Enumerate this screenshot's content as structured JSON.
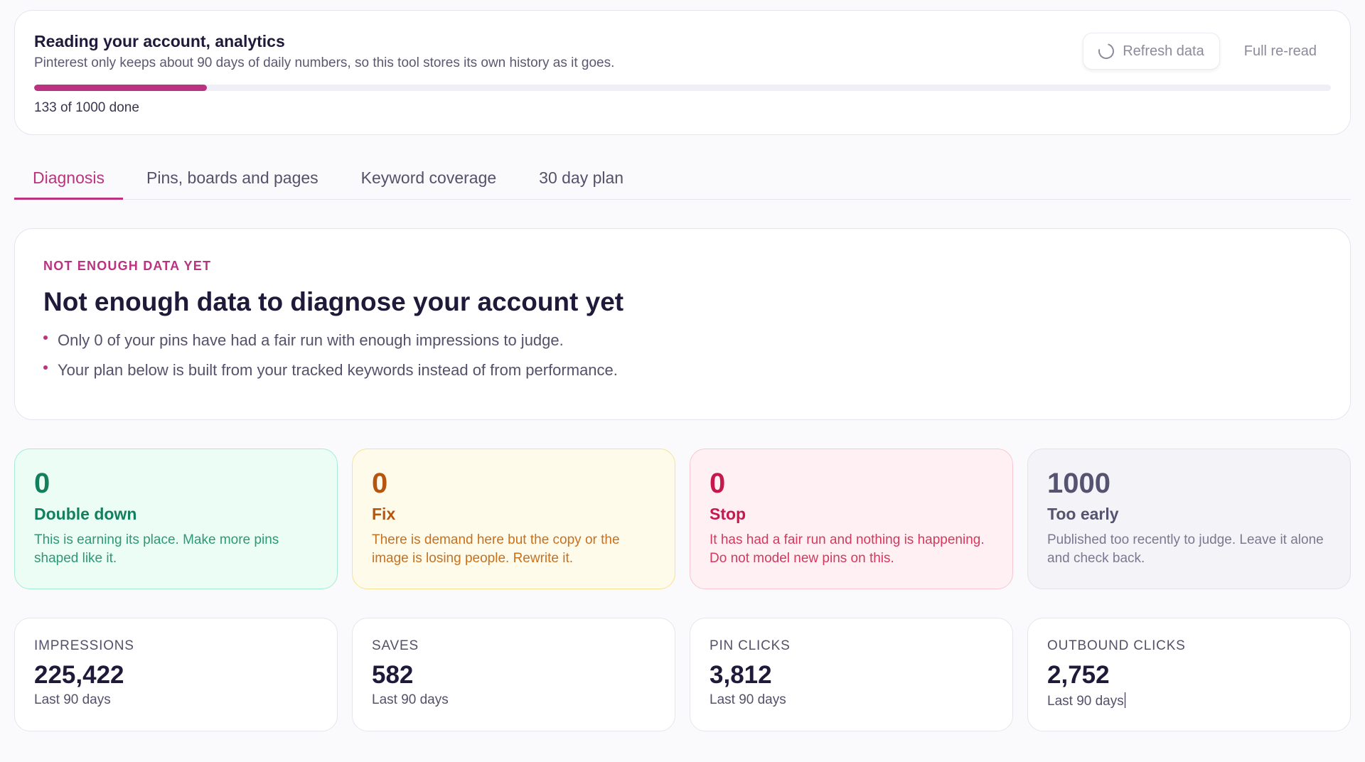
{
  "progress": {
    "title": "Reading your account, analytics",
    "subtitle": "Pinterest only keeps about 90 days of daily numbers, so this tool stores its own history as it goes.",
    "refresh_label": "Refresh data",
    "reread_label": "Full re-read",
    "done": 133,
    "total": 1000,
    "count_text": "133 of 1000 done",
    "accent": "#bb3281"
  },
  "tabs": [
    {
      "label": "Diagnosis",
      "active": true
    },
    {
      "label": "Pins, boards and pages",
      "active": false
    },
    {
      "label": "Keyword coverage",
      "active": false
    },
    {
      "label": "30 day plan",
      "active": false
    }
  ],
  "diagnosis": {
    "eyebrow": "NOT ENOUGH DATA YET",
    "title": "Not enough data to diagnose your account yet",
    "points": [
      "Only 0 of your pins have had a fair run with enough impressions to judge.",
      "Your plan below is built from your tracked keywords instead of from performance."
    ]
  },
  "buckets": [
    {
      "count": "0",
      "name": "Double down",
      "desc": "This is earning its place. Make more pins shaped like it.",
      "color": "#137f5c"
    },
    {
      "count": "0",
      "name": "Fix",
      "desc": "There is demand here but the copy or the image is losing people. Rewrite it.",
      "color": "#b5550e"
    },
    {
      "count": "0",
      "name": "Stop",
      "desc": "It has had a fair run and nothing is happening. Do not model new pins on this.",
      "color": "#c7184d"
    },
    {
      "count": "1000",
      "name": "Too early",
      "desc": "Published too recently to judge. Leave it alone and check back.",
      "color": "#565370"
    }
  ],
  "metrics": [
    {
      "label": "IMPRESSIONS",
      "value": "225,422",
      "period": "Last 90 days"
    },
    {
      "label": "SAVES",
      "value": "582",
      "period": "Last 90 days"
    },
    {
      "label": "PIN CLICKS",
      "value": "3,812",
      "period": "Last 90 days"
    },
    {
      "label": "OUTBOUND CLICKS",
      "value": "2,752",
      "period": "Last 90 days"
    }
  ]
}
